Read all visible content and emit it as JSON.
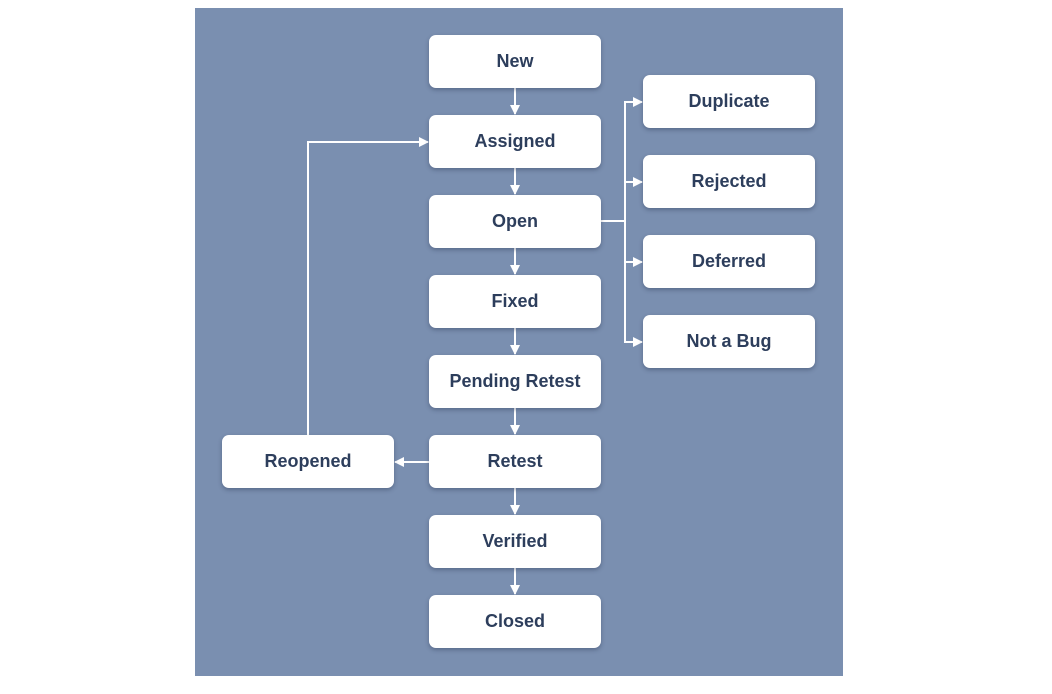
{
  "colors": {
    "background": "#7a8fb0",
    "box": "#ffffff",
    "text": "#2d3e5c",
    "arrow": "#ffffff"
  },
  "nodes": {
    "new": "New",
    "assigned": "Assigned",
    "open": "Open",
    "fixed": "Fixed",
    "pending_retest": "Pending Retest",
    "retest": "Retest",
    "verified": "Verified",
    "closed": "Closed",
    "duplicate": "Duplicate",
    "rejected": "Rejected",
    "deferred": "Deferred",
    "not_a_bug": "Not a Bug",
    "reopened": "Reopened"
  }
}
